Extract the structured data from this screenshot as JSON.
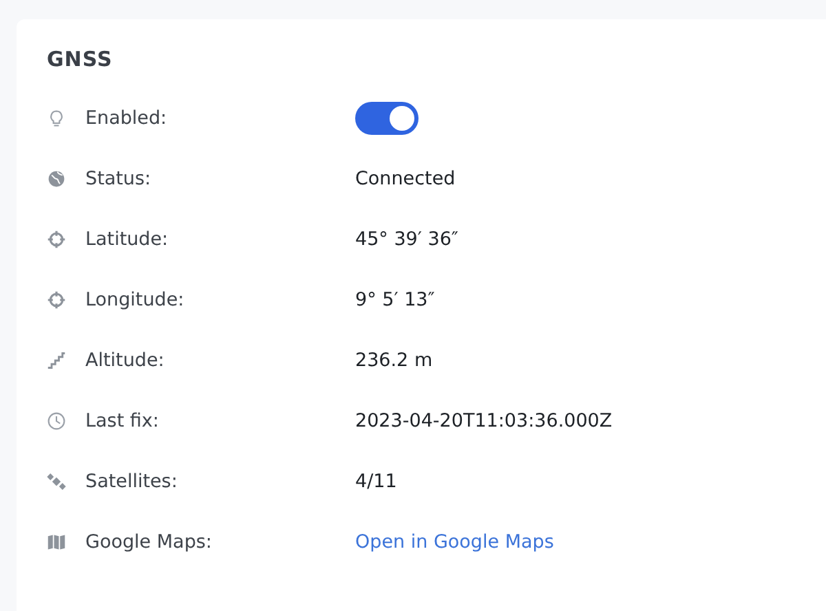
{
  "card": {
    "title": "GNSS",
    "rows": [
      {
        "label": "Enabled:",
        "kind": "toggle",
        "on": true
      },
      {
        "label": "Status:",
        "kind": "text",
        "value": "Connected"
      },
      {
        "label": "Latitude:",
        "kind": "text",
        "value": "45° 39′ 36″"
      },
      {
        "label": "Longitude:",
        "kind": "text",
        "value": "9° 5′ 13″"
      },
      {
        "label": "Altitude:",
        "kind": "text",
        "value": "236.2 m"
      },
      {
        "label": "Last fix:",
        "kind": "text",
        "value": "2023-04-20T11:03:36.000Z"
      },
      {
        "label": "Satellites:",
        "kind": "text",
        "value": "4/11"
      },
      {
        "label": "Google Maps:",
        "kind": "link",
        "value": "Open in Google Maps"
      }
    ]
  }
}
